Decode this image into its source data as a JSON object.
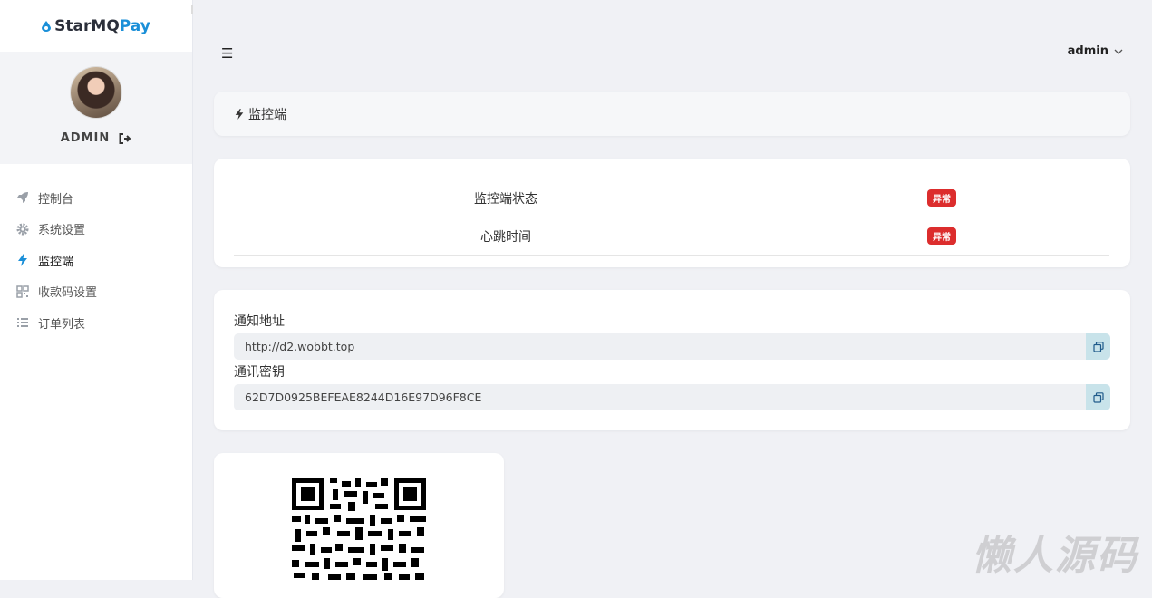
{
  "app": {
    "logo_part1": "StarMQ",
    "logo_part2": "Pay",
    "brand_color": "#1a8fd8"
  },
  "profile": {
    "name": "ADMIN",
    "avatar_icon": "avatar"
  },
  "sidebar": {
    "items": [
      {
        "label": "控制台",
        "icon": "rocket-icon"
      },
      {
        "label": "系统设置",
        "icon": "gear-icon"
      },
      {
        "label": "监控端",
        "icon": "bolt-icon",
        "active": true
      },
      {
        "label": "收款码设置",
        "icon": "qrcode-icon"
      },
      {
        "label": "订单列表",
        "icon": "list-icon"
      }
    ]
  },
  "header": {
    "user": "admin"
  },
  "breadcrumb": {
    "title": "监控端"
  },
  "status": {
    "rows": [
      {
        "label": "监控端状态",
        "badge": "异常"
      },
      {
        "label": "心跳时间",
        "badge": "异常"
      }
    ],
    "badge_color": "#dc2d2d"
  },
  "config": {
    "notify_label": "通知地址",
    "notify_value": "http://d2.wobbt.top",
    "key_label": "通讯密钥",
    "key_value": "62D7D0925BEFEAE8244D16E97D96F8CE"
  },
  "watermark": "懒人源码"
}
